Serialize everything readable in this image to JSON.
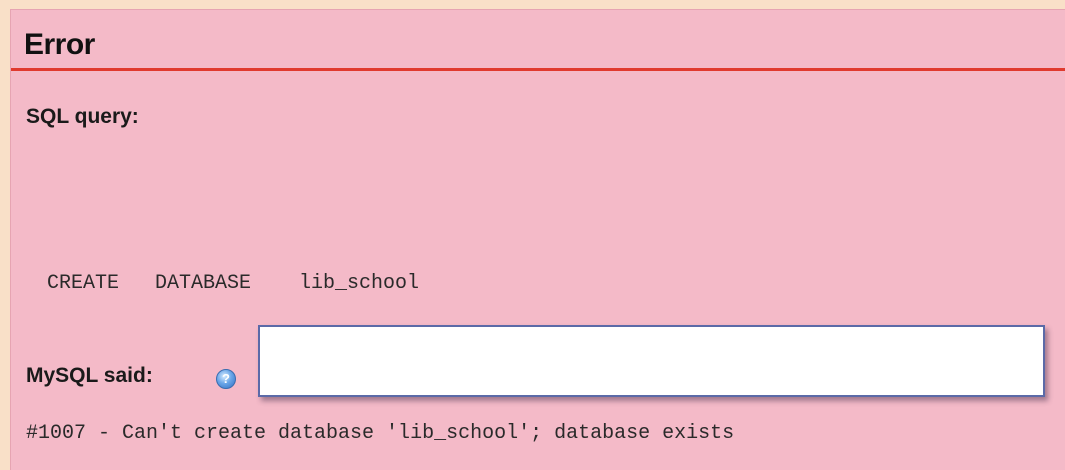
{
  "error": {
    "title": "Error",
    "sql_label": "SQL query:",
    "sql_query": "CREATE   DATABASE    lib_school",
    "mysql_label": "MySQL said:",
    "help_icon": "help-icon",
    "message": "#1007 - Can't create database 'lib_school'; database exists"
  },
  "colors": {
    "outer_background": "#f9e0c8",
    "panel_background": "#f4bac8",
    "title_rule": "#e03a2e",
    "popup_border": "#5b6aa8"
  }
}
